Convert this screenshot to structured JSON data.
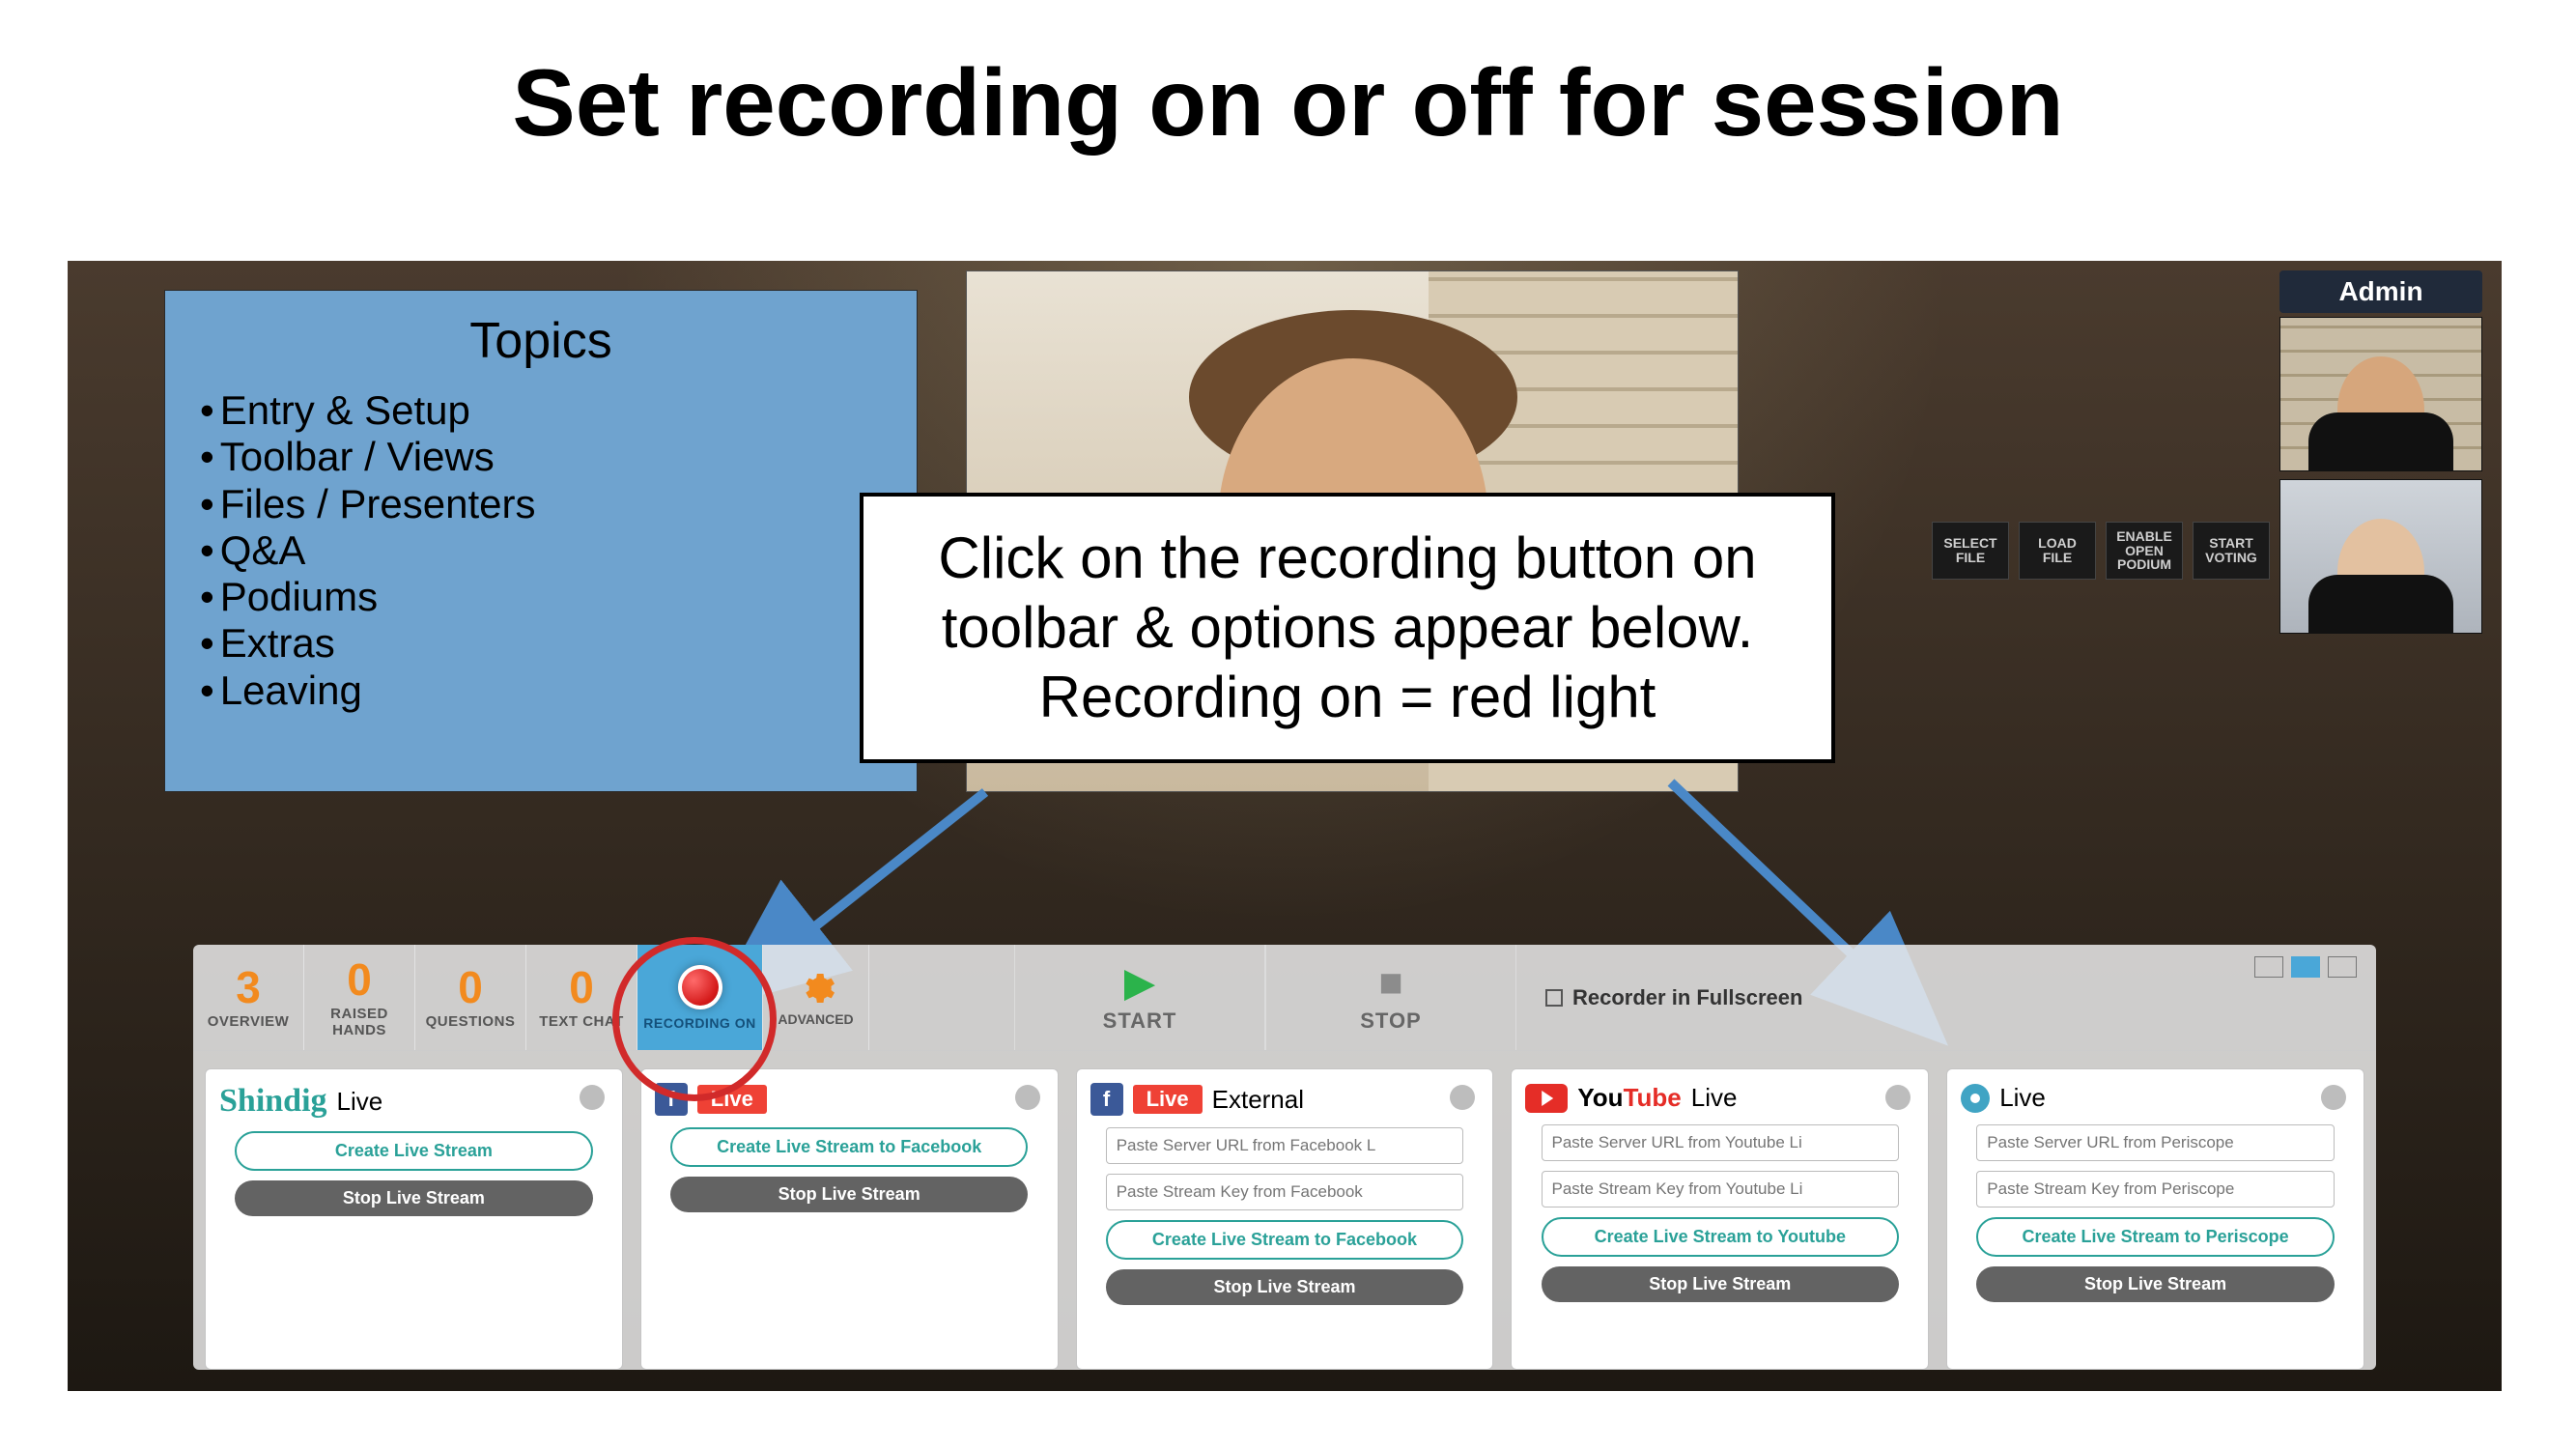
{
  "slide_title": "Set recording on or off for session",
  "topics": {
    "heading": "Topics",
    "items": [
      "Entry & Setup",
      "Toolbar / Views",
      "Files / Presenters",
      "Q&A",
      "Podiums",
      "Extras",
      "Leaving"
    ]
  },
  "admin_label": "Admin",
  "control_buttons": [
    "SELECT FILE",
    "LOAD FILE",
    "ENABLE OPEN PODIUM",
    "START VOTING"
  ],
  "callout": "Click on the recording button on toolbar & options appear below. Recording on = red light",
  "toolbar": {
    "counters": [
      {
        "num": "3",
        "label": "OVERVIEW"
      },
      {
        "num": "0",
        "label": "RAISED HANDS"
      },
      {
        "num": "0",
        "label": "QUESTIONS"
      },
      {
        "num": "0",
        "label": "TEXT CHAT"
      }
    ],
    "recording_label": "RECORDING ON",
    "advanced_label": "ADVANCED",
    "start_label": "START",
    "stop_label": "STOP",
    "fullscreen_label": "Recorder in Fullscreen"
  },
  "cards": {
    "shindig": {
      "brand": "Shindig",
      "live": "Live",
      "create": "Create Live Stream",
      "stop": "Stop Live Stream"
    },
    "fb_internal": {
      "live": "Live",
      "create": "Create Live Stream to Facebook",
      "stop": "Stop Live Stream"
    },
    "fb_external": {
      "live": "Live",
      "ext": "External",
      "url_ph": "Paste Server URL from Facebook L",
      "key_ph": "Paste Stream Key from Facebook",
      "create": "Create Live Stream to Facebook",
      "stop": "Stop Live Stream"
    },
    "youtube": {
      "brand_you": "You",
      "brand_tube": "Tube",
      "live": "Live",
      "url_ph": "Paste Server URL from Youtube Li",
      "key_ph": "Paste Stream Key from Youtube Li",
      "create": "Create Live Stream to Youtube",
      "stop": "Stop Live Stream"
    },
    "periscope": {
      "live": "Live",
      "url_ph": "Paste Server URL from Periscope",
      "key_ph": "Paste Stream Key from Periscope",
      "create": "Create Live Stream to Periscope",
      "stop": "Stop Live Stream"
    }
  }
}
